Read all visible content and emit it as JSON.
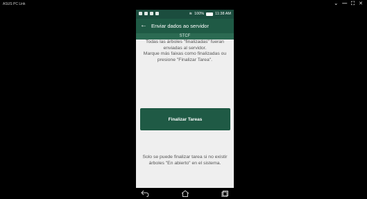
{
  "host": {
    "title": "ASUS PC Link",
    "controls": [
      "⌄",
      "—",
      "⛶",
      "✕"
    ]
  },
  "status_bar": {
    "battery": "100%",
    "time": "11:38 AM"
  },
  "app_bar": {
    "title": "Enviar dados ao servidor"
  },
  "sub_bar": {
    "label": "STCF"
  },
  "main": {
    "message_top": "Todas las árboles \"finalizadas\" fueran enviadas al servidor.\nMarque más faixas como finalizadas ou presione \"Finalizar Tarea\".",
    "finalize_button": "Finalizar Tareas",
    "message_bottom": "Solo se puede finalizar tarea si no existir árboles \"En abierto\" en el sistema."
  },
  "colors": {
    "status_bar": "#1b4d3e",
    "app_bar": "#1f5a45",
    "sub_bar": "#2b6a52",
    "button": "#1f5a45"
  }
}
